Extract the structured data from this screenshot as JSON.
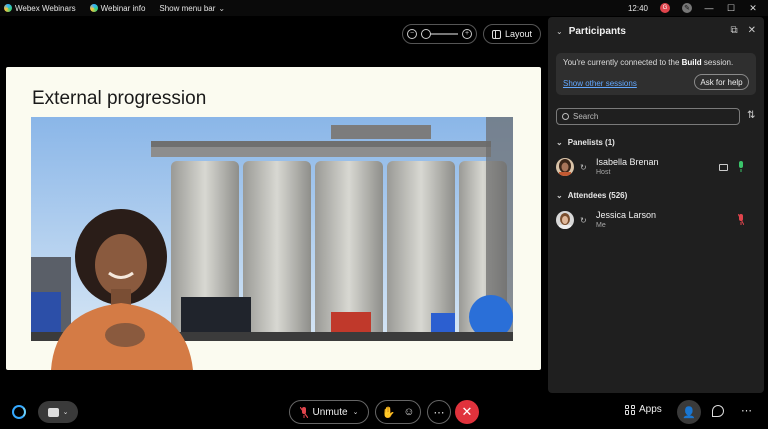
{
  "titlebar": {
    "app_name": "Webex Webinars",
    "webinar_info": "Webinar info",
    "menu_toggle": "Show menu bar",
    "clock": "12:40",
    "avatar_initial": "G"
  },
  "controls": {
    "layout_label": "Layout"
  },
  "slide": {
    "title": "External progression"
  },
  "participants": {
    "title": "Participants",
    "notice_prefix": "You're currently connected to the ",
    "notice_session": "Build",
    "notice_suffix": " session.",
    "other_sessions_link": "Show other sessions",
    "help_button": "Ask for help",
    "search_placeholder": "Search",
    "panelists_header": "Panelists (1)",
    "attendees_header": "Attendees (526)",
    "panelists": [
      {
        "name": "Isabella Brenan",
        "role": "Host"
      }
    ],
    "attendees": [
      {
        "name": "Jessica Larson",
        "role": "Me"
      }
    ]
  },
  "bottombar": {
    "unmute_label": "Unmute",
    "apps_label": "Apps"
  },
  "colors": {
    "accent_blue": "#62a8ff",
    "end_call_red": "#e0323c",
    "mic_active_green": "#3ac46a",
    "mic_muted_red": "#e0444c"
  }
}
